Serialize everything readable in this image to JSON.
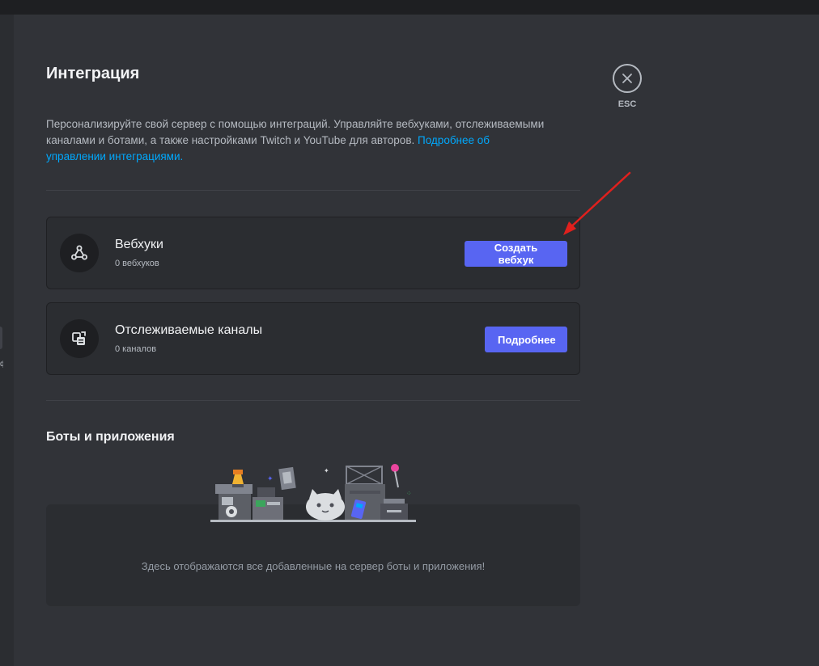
{
  "header": {
    "title": "Интеграция",
    "description": "Персонализируйте свой сервер с помощью интеграций. Управляйте вебхуками, отслеживаемыми каналами и ботами, а также настройками Twitch и YouTube для авторов.",
    "link_text": "Подробнее об управлении интеграциями."
  },
  "close": {
    "icon": "close-icon",
    "label": "ESC"
  },
  "cards": [
    {
      "icon": "webhook-icon",
      "title": "Вебхуки",
      "subtitle": "0 вебхуков",
      "button_label": "Создать вебхук"
    },
    {
      "icon": "followed-channel-icon",
      "title": "Отслеживаемые каналы",
      "subtitle": "0 каналов",
      "button_label": "Подробнее"
    }
  ],
  "bots": {
    "title": "Боты и приложения",
    "empty_text": "Здесь отображаются все добавленные на сервер боты и приложения!"
  },
  "colors": {
    "accent": "#5865f2",
    "link": "#00a8fc",
    "annotation_arrow": "#e0201d"
  }
}
